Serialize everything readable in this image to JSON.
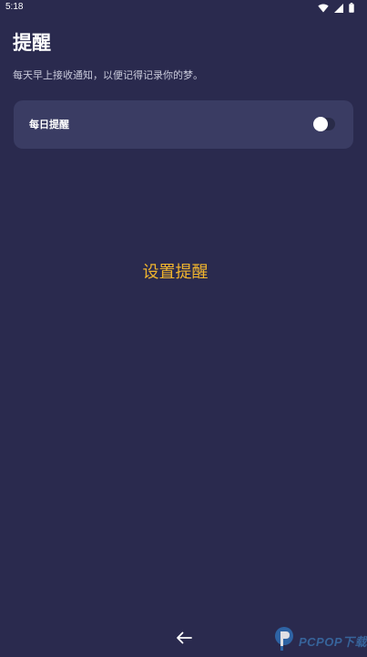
{
  "status_bar": {
    "time": "5:18",
    "icons": [
      "wifi-icon",
      "signal-icon",
      "battery-icon"
    ]
  },
  "header": {
    "title": "提醒",
    "subtitle": "每天早上接收通知，以便记得记录你的梦。"
  },
  "settings": {
    "daily_reminder": {
      "label": "每日提醒",
      "enabled": false
    }
  },
  "main": {
    "action_label": "设置提醒"
  },
  "nav": {
    "back_icon": "arrow-left-icon"
  },
  "watermark": {
    "text": "PCPOP下载"
  },
  "colors": {
    "background": "#2a2a4e",
    "card": "#3a3c63",
    "accent": "#f1b52d",
    "text": "#ffffff",
    "subtext": "#c9cadb"
  }
}
